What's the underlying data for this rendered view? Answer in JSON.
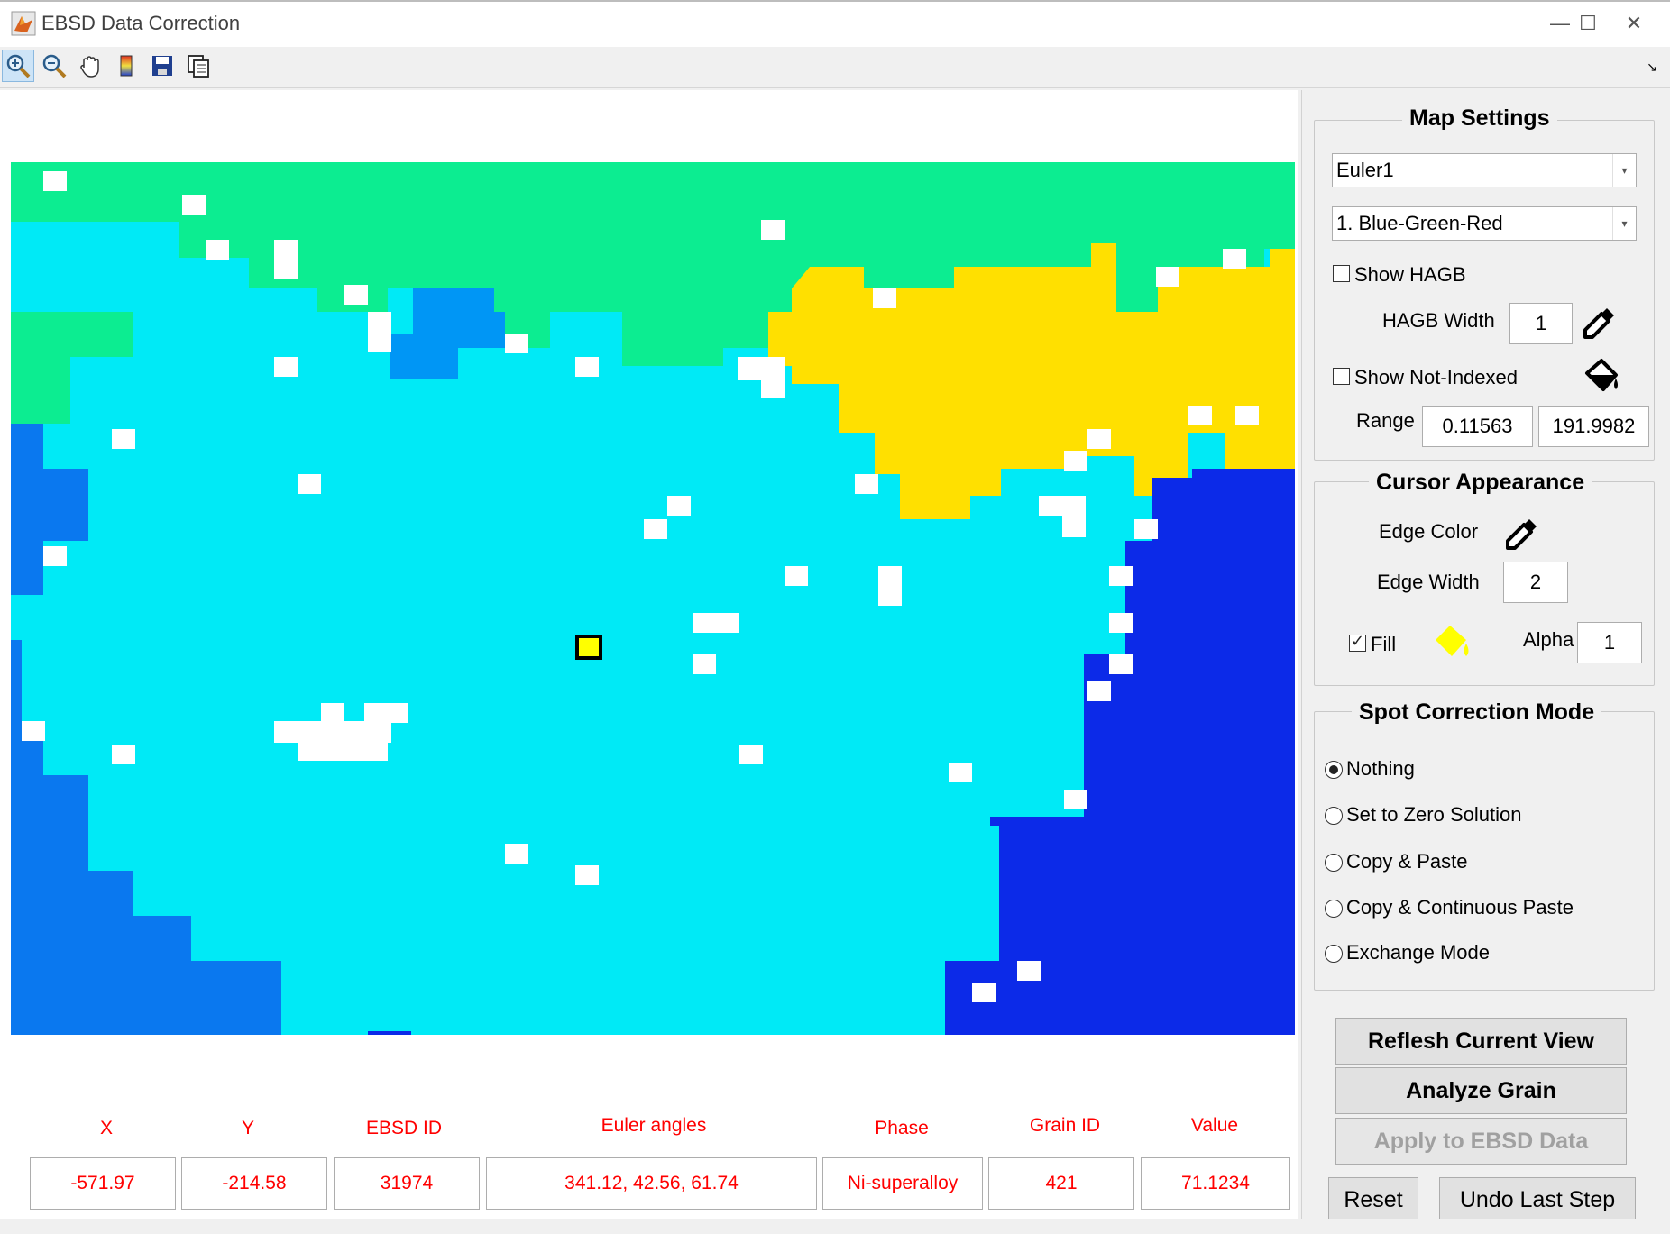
{
  "window": {
    "title": "EBSD Data Correction",
    "minimize": "—",
    "maximize": "☐",
    "close": "✕"
  },
  "toolbar": {
    "tools": [
      "zoom-in-icon",
      "zoom-out-icon",
      "pan-hand-icon",
      "colorbar-icon",
      "save-icon",
      "copy-figure-icon"
    ],
    "dock": "↘"
  },
  "map_settings": {
    "title": "Map Settings",
    "property_select": "Euler1",
    "colormap_select": "1. Blue-Green-Red",
    "show_hagb_label": "Show HAGB",
    "show_hagb_checked": false,
    "hagb_width_label": "HAGB Width",
    "hagb_width_value": "1",
    "show_not_indexed_label": "Show Not-Indexed",
    "show_not_indexed_checked": false,
    "range_label": "Range",
    "range_min": "0.11563",
    "range_max": "191.9982"
  },
  "cursor_appearance": {
    "title": "Cursor Appearance",
    "edge_color_label": "Edge Color",
    "edge_width_label": "Edge Width",
    "edge_width_value": "2",
    "fill_label": "Fill",
    "fill_checked": true,
    "fill_color": "#ffff00",
    "alpha_label": "Alpha",
    "alpha_value": "1"
  },
  "spot_correction": {
    "title": "Spot Correction Mode",
    "options": [
      "Nothing",
      "Set to Zero Solution",
      "Copy & Paste",
      "Copy & Continuous Paste",
      "Exchange Mode"
    ],
    "selected": 0
  },
  "buttons": {
    "refresh": "Reflesh Current View",
    "analyze": "Analyze Grain",
    "apply": "Apply to EBSD Data",
    "reset": "Reset",
    "undo": "Undo Last Step"
  },
  "readout": {
    "headers": [
      "X",
      "Y",
      "EBSD ID",
      "Euler angles",
      "Phase",
      "Grain ID",
      "Value"
    ],
    "values": [
      "-571.97",
      "-214.58",
      "31974",
      "341.12, 42.56, 61.74",
      "Ni-superalloy",
      "421",
      "71.1234"
    ]
  },
  "colors": {
    "green_grain": "#0ced91",
    "cyan_grain": "#00eaf6",
    "light_blue_grain": "#0096f5",
    "mid_blue_grain": "#0a78ef",
    "dark_blue_grain": "#0c2ae8",
    "yellow_grain": "#ffe000",
    "not_indexed": "#ffffff",
    "cursor_fill": "#ffff00",
    "readout_text": "#ff0000"
  }
}
